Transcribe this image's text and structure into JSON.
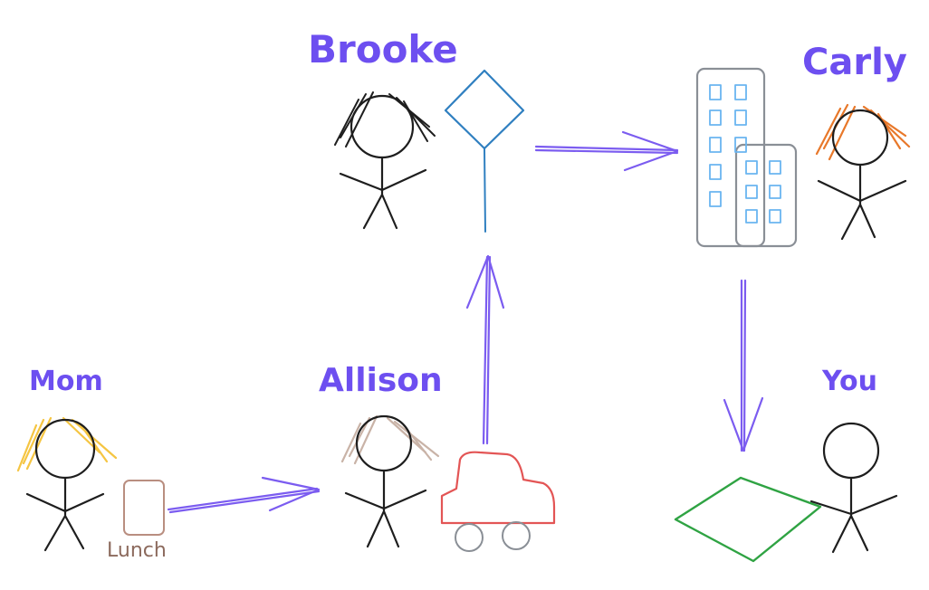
{
  "people": {
    "mom": "Mom",
    "allison": "Allison",
    "brooke": "Brooke",
    "carly": "Carly",
    "you": "You"
  },
  "items": {
    "lunch": "Lunch"
  },
  "colors": {
    "label": "#6d4ff0",
    "arrow": "#7b5cf0",
    "mom_hair": "#f5c542",
    "allison_hair": "#c9b3a7",
    "carly_hair": "#e8782a",
    "lunch_box": "#b98e80",
    "car": "#e35555",
    "sign": "#4aa3e0",
    "building": "#8a8f96",
    "window": "#6ab5f0",
    "grass": "#3cb043"
  }
}
